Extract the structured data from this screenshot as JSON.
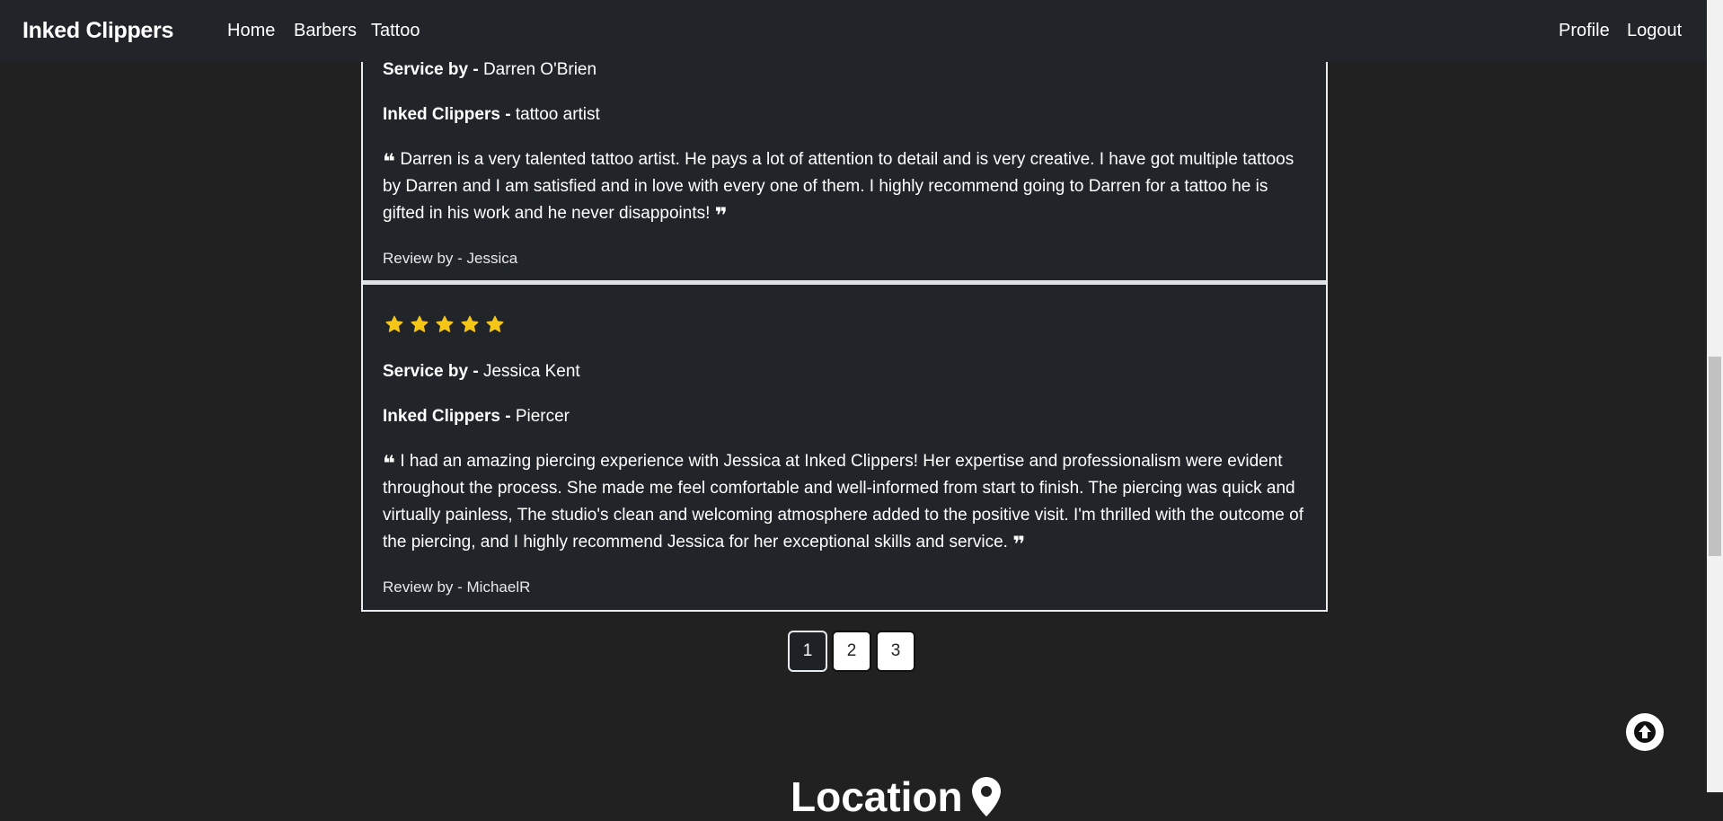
{
  "nav": {
    "brand": "Inked Clippers",
    "links": [
      "Home",
      "Barbers",
      "Tattoo"
    ],
    "profile": "Profile",
    "logout": "Logout"
  },
  "reviews": [
    {
      "service_label": "Service by -",
      "service_name": "Darren O'Brien",
      "shop_label": "Inked Clippers -",
      "role": "tattoo artist",
      "text": "Darren is a very talented tattoo artist. He pays a lot of attention to detail and is very creative. I have got multiple tattoos by Darren and I am satisfied and in love with every one of them. I highly recommend going to Darren for a tattoo he is gifted in his work and he never disappoints!",
      "byline": "Review by - Jessica"
    },
    {
      "rating": 5,
      "service_label": "Service by -",
      "service_name": "Jessica Kent",
      "shop_label": "Inked Clippers -",
      "role": "Piercer",
      "text": "I had an amazing piercing experience with Jessica at Inked Clippers! Her expertise and professionalism were evident throughout the process. She made me feel comfortable and well-informed from start to finish. The piercing was quick and virtually painless, The studio's clean and welcoming atmosphere added to the positive visit. I'm thrilled with the outcome of the piercing, and I highly recommend Jessica for her exceptional skills and service.",
      "byline": "Review by - MichaelR"
    }
  ],
  "pagination": {
    "pages": [
      "1",
      "2",
      "3"
    ],
    "active": "1"
  },
  "location_heading": "Location",
  "icons": {
    "star": "star-icon",
    "quote_open": "quote-open-icon",
    "quote_close": "quote-close-icon",
    "scroll_top": "arrow-up-circle-icon",
    "location": "map-pin-icon"
  },
  "colors": {
    "star": "#f5c518",
    "background": "#212121",
    "card": "#212529"
  }
}
